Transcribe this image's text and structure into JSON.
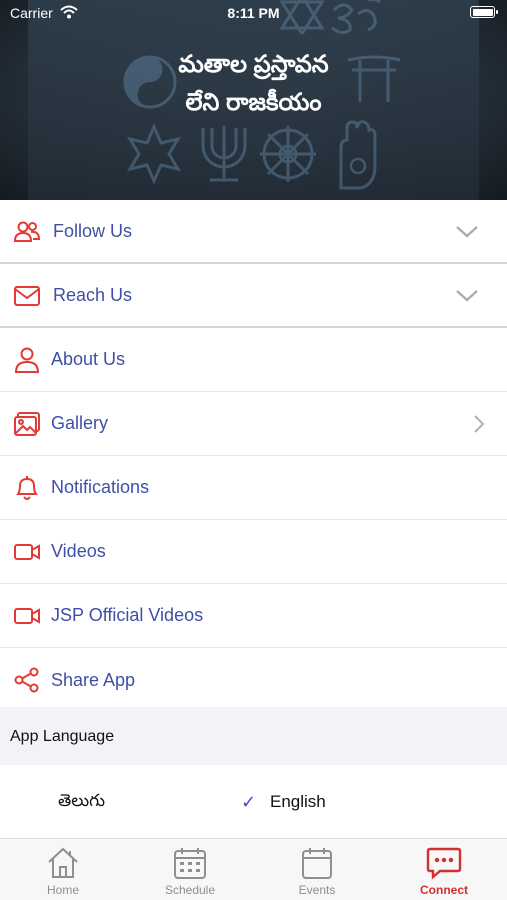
{
  "status_bar": {
    "carrier": "Carrier",
    "time": "8:11 PM"
  },
  "banner": {
    "title_line1": "మతాల ప్రస్తావన",
    "title_line2": "లేని రాజకీయం"
  },
  "menu": {
    "items": [
      {
        "label": "Follow Us",
        "icon": "people-icon",
        "accessory": "chevron-down"
      },
      {
        "label": "Reach Us",
        "icon": "mail-icon",
        "accessory": "chevron-down"
      },
      {
        "label": "About Us",
        "icon": "person-icon",
        "accessory": "none"
      },
      {
        "label": "Gallery",
        "icon": "gallery-icon",
        "accessory": "chevron-right"
      },
      {
        "label": "Notifications",
        "icon": "bell-icon",
        "accessory": "none"
      },
      {
        "label": "Videos",
        "icon": "video-icon",
        "accessory": "none"
      },
      {
        "label": "JSP Official Videos",
        "icon": "video-icon",
        "accessory": "none"
      },
      {
        "label": "Share App",
        "icon": "share-icon",
        "accessory": "none"
      }
    ]
  },
  "language": {
    "header": "App Language",
    "options": [
      "తెలుగు",
      "English"
    ],
    "selected": "English",
    "check_glyph": "✓"
  },
  "tabbar": {
    "tabs": [
      {
        "label": "Home",
        "icon": "home-icon"
      },
      {
        "label": "Schedule",
        "icon": "calendar-icon"
      },
      {
        "label": "Events",
        "icon": "events-icon"
      },
      {
        "label": "Connect",
        "icon": "chat-icon"
      }
    ],
    "active": "Connect"
  },
  "colors": {
    "accent_red": "#e53935",
    "label_blue": "#3f4fa6",
    "check_purple": "#5b3bdc"
  }
}
